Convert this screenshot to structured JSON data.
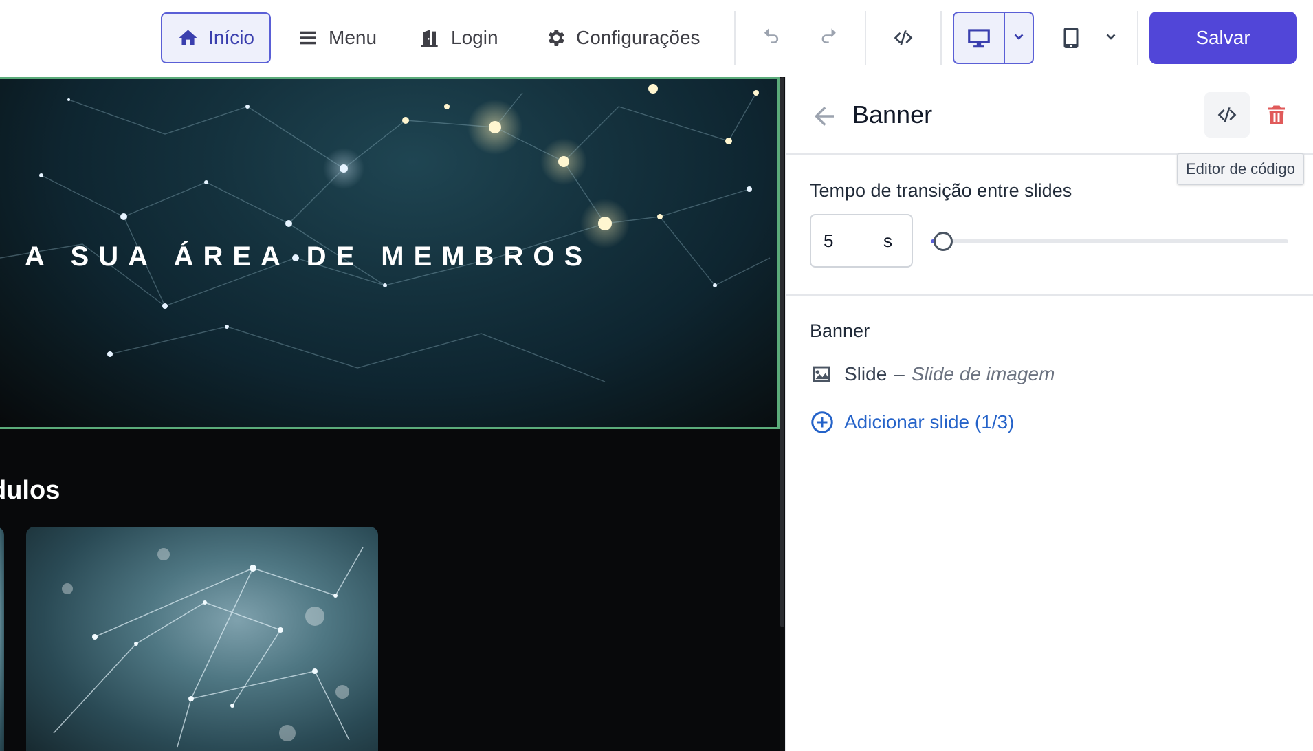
{
  "toolbar": {
    "home_label": "Início",
    "menu_label": "Menu",
    "login_label": "Login",
    "settings_label": "Configurações",
    "save_label": "Salvar"
  },
  "canvas": {
    "banner_title": "A SUA ÁREA DE MEMBROS",
    "modules_title": "dulos"
  },
  "panel": {
    "title": "Banner",
    "tooltip": "Editor de código",
    "transition_label": "Tempo de transição entre slides",
    "transition_value": "5",
    "transition_unit": "s",
    "transition_slider_fraction": 0.0,
    "section_label": "Banner",
    "slide_name": "Slide",
    "slide_sep": "–",
    "slide_type": "Slide de imagem",
    "add_slide_label": "Adicionar slide (1/3)"
  },
  "colors": {
    "accent": "#5146d8",
    "selection_border": "#5bab7a",
    "link": "#2563c9",
    "danger": "#e05a5a"
  }
}
